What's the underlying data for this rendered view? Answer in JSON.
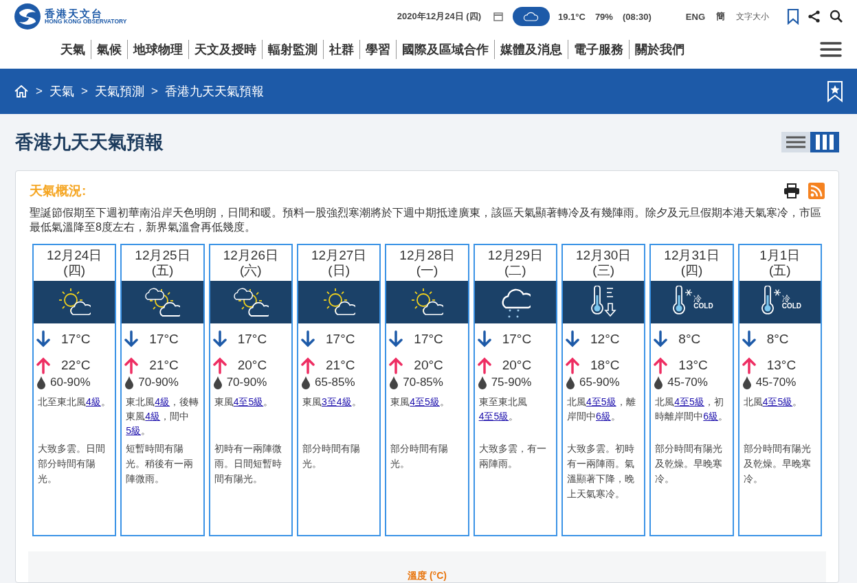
{
  "header": {
    "logo_chinese": "香港天文台",
    "logo_english": "HONG KONG OBSERVATORY",
    "date": "2020年12月24日 (四)",
    "temperature": "19.1°C",
    "humidity": "79%",
    "time": "(08:30)",
    "language_links": [
      "ENG",
      "簡"
    ],
    "font_size": "文字大小"
  },
  "nav": [
    "天氣",
    "氣候",
    "地球物理",
    "天文及授時",
    "輻射監測",
    "社群",
    "學習",
    "國際及區域合作",
    "媒體及消息",
    "電子服務",
    "關於我們"
  ],
  "breadcrumb": {
    "separator": ">",
    "items": [
      "天氣",
      "天氣預測",
      "香港九天天氣預報"
    ]
  },
  "page_title": "香港九天天氣預報",
  "view_toggle": [
    {
      "kind": "list",
      "selected": false
    },
    {
      "kind": "columns",
      "selected": true
    }
  ],
  "overview": {
    "title": "天氣概況:",
    "text": "聖誕節假期至下週初華南沿岸天色明朗，日間和暖。預料一股強烈寒潮將於下週中期抵達廣東，該區天氣顯著轉冷及有幾陣雨。除夕及元旦假期本港天氣寒冷，市區最低氣溫降至8度左右，新界氣溫會再低幾度。"
  },
  "days": [
    {
      "date": "12月24日",
      "weekday": "(四)",
      "kind": "sun-cloud",
      "min": "17°C",
      "max": "22°C",
      "humidity": "60-90%",
      "wind": [
        {
          "text": "北至東北風"
        },
        {
          "text": "4級",
          "link": true
        },
        {
          "text": "。"
        }
      ],
      "description": "大致多雲。日間部分時間有陽光。"
    },
    {
      "date": "12月25日",
      "weekday": "(五)",
      "kind": "clouds-sun",
      "min": "17°C",
      "max": "21°C",
      "humidity": "70-90%",
      "wind": [
        {
          "text": "東北風"
        },
        {
          "text": "4級",
          "link": true
        },
        {
          "text": "，後轉東風"
        },
        {
          "text": "4級",
          "link": true
        },
        {
          "text": "，間中"
        },
        {
          "text": "5級",
          "link": true
        },
        {
          "text": "。"
        }
      ],
      "description": "短暫時間有陽光。稍後有一兩陣微雨。"
    },
    {
      "date": "12月26日",
      "weekday": "(六)",
      "kind": "clouds-sun",
      "min": "17°C",
      "max": "20°C",
      "humidity": "70-90%",
      "wind": [
        {
          "text": "東風"
        },
        {
          "text": "4至5級",
          "link": true
        },
        {
          "text": "。"
        }
      ],
      "description": "初時有一兩陣微雨。日間短暫時間有陽光。"
    },
    {
      "date": "12月27日",
      "weekday": "(日)",
      "kind": "sun-cloud",
      "min": "17°C",
      "max": "21°C",
      "humidity": "65-85%",
      "wind": [
        {
          "text": "東風"
        },
        {
          "text": "3至4級",
          "link": true
        },
        {
          "text": "。"
        }
      ],
      "description": "部分時間有陽光。"
    },
    {
      "date": "12月28日",
      "weekday": "(一)",
      "kind": "sun-cloud",
      "min": "17°C",
      "max": "20°C",
      "humidity": "70-85%",
      "wind": [
        {
          "text": "東風"
        },
        {
          "text": "4至5級",
          "link": true
        },
        {
          "text": "。"
        }
      ],
      "description": "部分時間有陽光。"
    },
    {
      "date": "12月29日",
      "weekday": "(二)",
      "kind": "rain",
      "min": "17°C",
      "max": "20°C",
      "humidity": "75-90%",
      "wind": [
        {
          "text": "東至東北風"
        },
        {
          "text": "4至5級",
          "link": true
        },
        {
          "text": "。"
        }
      ],
      "description": "大致多雲，有一兩陣雨。"
    },
    {
      "date": "12月30日",
      "weekday": "(三)",
      "kind": "cooling",
      "min": "12°C",
      "max": "18°C",
      "humidity": "65-90%",
      "wind": [
        {
          "text": "北風"
        },
        {
          "text": "4至5級",
          "link": true
        },
        {
          "text": "，離岸間中"
        },
        {
          "text": "6級",
          "link": true
        },
        {
          "text": "。"
        }
      ],
      "description": "大致多雲。初時有一兩陣雨。氣溫顯著下降，晚上天氣寒冷。"
    },
    {
      "date": "12月31日",
      "weekday": "(四)",
      "kind": "cold",
      "icon_labels": [
        "冷",
        "COLD"
      ],
      "min": "8°C",
      "max": "13°C",
      "humidity": "45-70%",
      "wind": [
        {
          "text": "北風"
        },
        {
          "text": "4至5級",
          "link": true
        },
        {
          "text": "，初時離岸間中"
        },
        {
          "text": "6級",
          "link": true
        },
        {
          "text": "。"
        }
      ],
      "description": "部分時間有陽光及乾燥。早晚寒冷。"
    },
    {
      "date": "1月1日",
      "weekday": "(五)",
      "kind": "cold",
      "icon_labels": [
        "冷",
        "COLD"
      ],
      "min": "8°C",
      "max": "13°C",
      "humidity": "45-70%",
      "wind": [
        {
          "text": "北風"
        },
        {
          "text": "4至5級",
          "link": true
        },
        {
          "text": "。"
        }
      ],
      "description": "部分時間有陽光及乾燥。早晚寒冷。"
    }
  ],
  "chart_panel": {
    "title": "溫度 (°C)"
  }
}
